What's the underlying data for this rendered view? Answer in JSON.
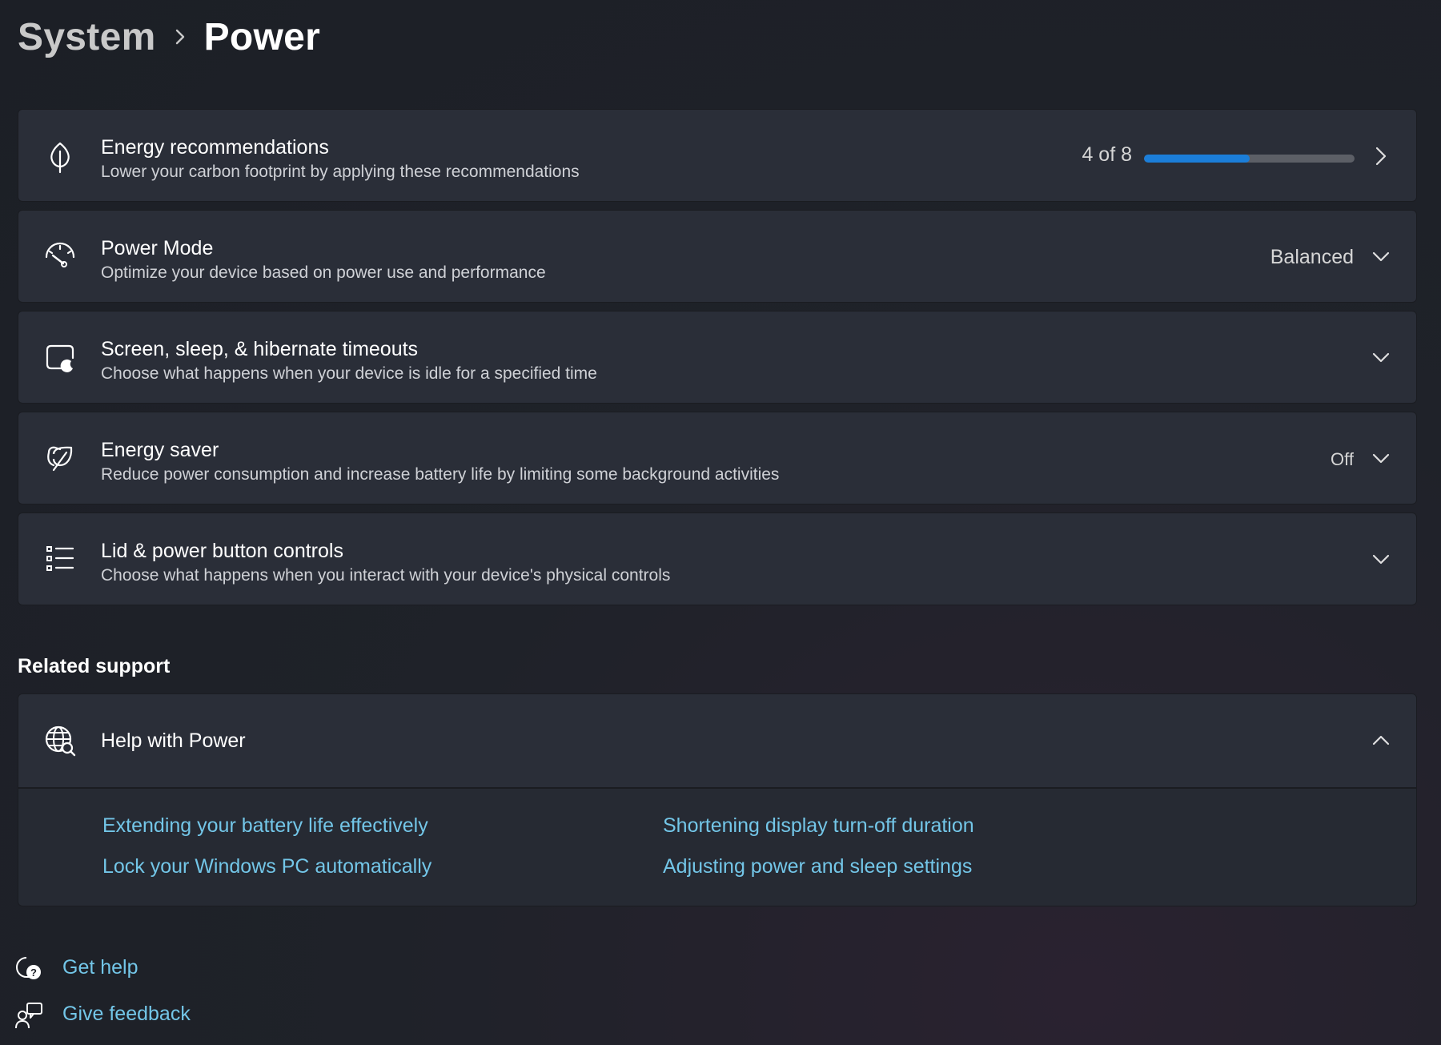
{
  "breadcrumb": {
    "parent": "System",
    "current": "Power"
  },
  "cards": {
    "energy_recommendations": {
      "title": "Energy recommendations",
      "description": "Lower your carbon footprint by applying these recommendations",
      "progress_label": "4 of 8",
      "progress_fraction": 0.5
    },
    "power_mode": {
      "title": "Power Mode",
      "description": "Optimize your device based on power use and performance",
      "value": "Balanced"
    },
    "screen_sleep": {
      "title": "Screen, sleep, & hibernate timeouts",
      "description": "Choose what happens when your device is idle for a specified time"
    },
    "energy_saver": {
      "title": "Energy saver",
      "description": "Reduce power consumption and increase battery life by limiting some background activities",
      "value": "Off"
    },
    "lid_power": {
      "title": "Lid & power button controls",
      "description": "Choose what happens when you interact with your device's physical controls"
    }
  },
  "related_support": {
    "title": "Related support",
    "help": {
      "title": "Help with Power",
      "links": [
        "Extending your battery life effectively",
        "Shortening display turn-off duration",
        "Lock your Windows PC automatically",
        "Adjusting power and sleep settings"
      ]
    }
  },
  "footer": {
    "get_help": "Get help",
    "give_feedback": "Give feedback"
  },
  "colors": {
    "accent": "#1b7ed9",
    "link": "#73c6e8",
    "card": "#2a2e38"
  },
  "icons": [
    "leaf-icon",
    "speedometer-icon",
    "screen-moon-icon",
    "energy-saver-leaf-icon",
    "list-icon",
    "globe-help-icon",
    "chevron-right-icon",
    "chevron-down-icon",
    "chevron-up-icon",
    "get-help-icon",
    "feedback-icon"
  ]
}
